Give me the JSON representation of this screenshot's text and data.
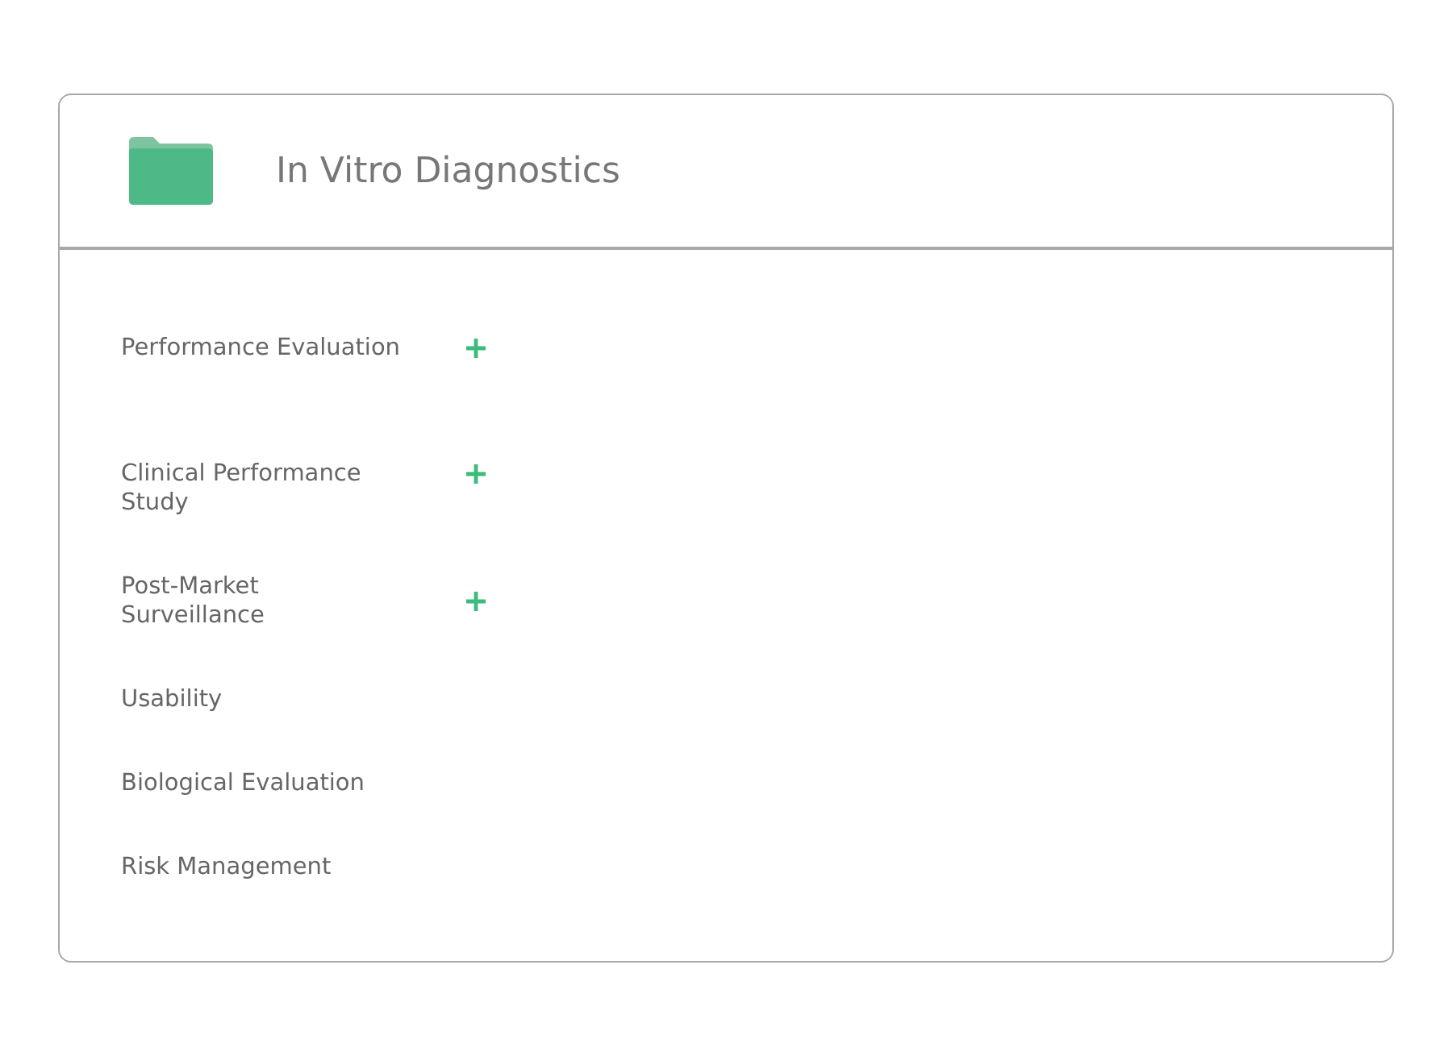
{
  "panel": {
    "title": "In Vitro Diagnostics"
  },
  "items": [
    {
      "label": "Performance Evaluation",
      "expandable": true
    },
    {
      "label": "Clinical Performance\nStudy",
      "expandable": true
    },
    {
      "label": "Post-Market\nSurveillance",
      "expandable": true
    },
    {
      "label": "Usability",
      "expandable": false
    },
    {
      "label": "Biological Evaluation",
      "expandable": false
    },
    {
      "label": "Risk Management",
      "expandable": false
    }
  ]
}
